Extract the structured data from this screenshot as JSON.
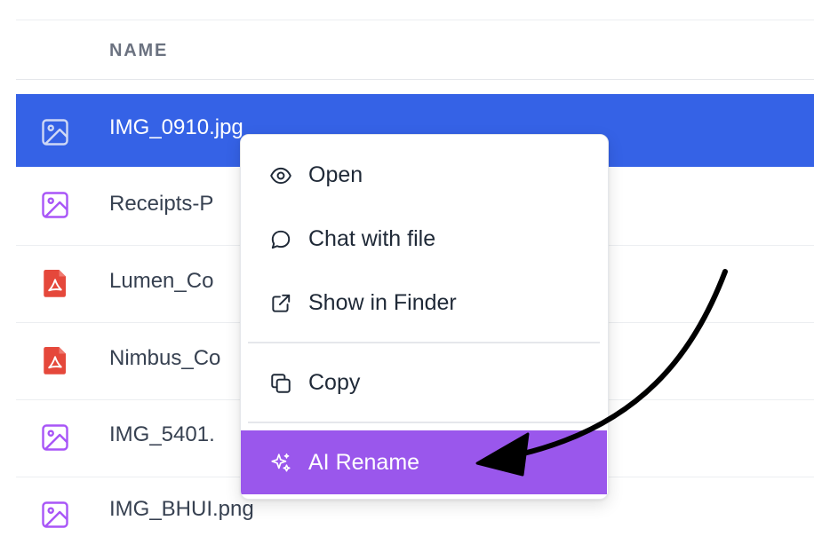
{
  "table": {
    "column_header": "NAME",
    "rows": [
      {
        "name": "IMG_0910.jpg",
        "icon": "image-icon",
        "selected": true
      },
      {
        "name": "Receipts-P",
        "icon": "image-icon",
        "selected": false
      },
      {
        "name": "Lumen_Co",
        "icon": "pdf-icon",
        "selected": false
      },
      {
        "name": "Nimbus_Co",
        "icon": "pdf-icon",
        "selected": false
      },
      {
        "name": "IMG_5401.",
        "icon": "image-icon",
        "selected": false
      },
      {
        "name": "IMG_BHUI.png",
        "icon": "image-icon",
        "selected": false
      }
    ]
  },
  "context_menu": {
    "items": [
      {
        "label": "Open",
        "icon": "eye-icon"
      },
      {
        "label": "Chat with file",
        "icon": "chat-bubble-icon"
      },
      {
        "label": "Show in Finder",
        "icon": "external-link-icon"
      },
      {
        "label": "Copy",
        "icon": "copy-icon"
      },
      {
        "label": "AI Rename",
        "icon": "sparkles-icon"
      }
    ]
  },
  "colors": {
    "selected_row": "#3562e6",
    "highlight_item": "#9a57ec",
    "image_icon": "#a855f7",
    "pdf_icon": "#e5483b",
    "annotation_arrow": "#000000"
  }
}
